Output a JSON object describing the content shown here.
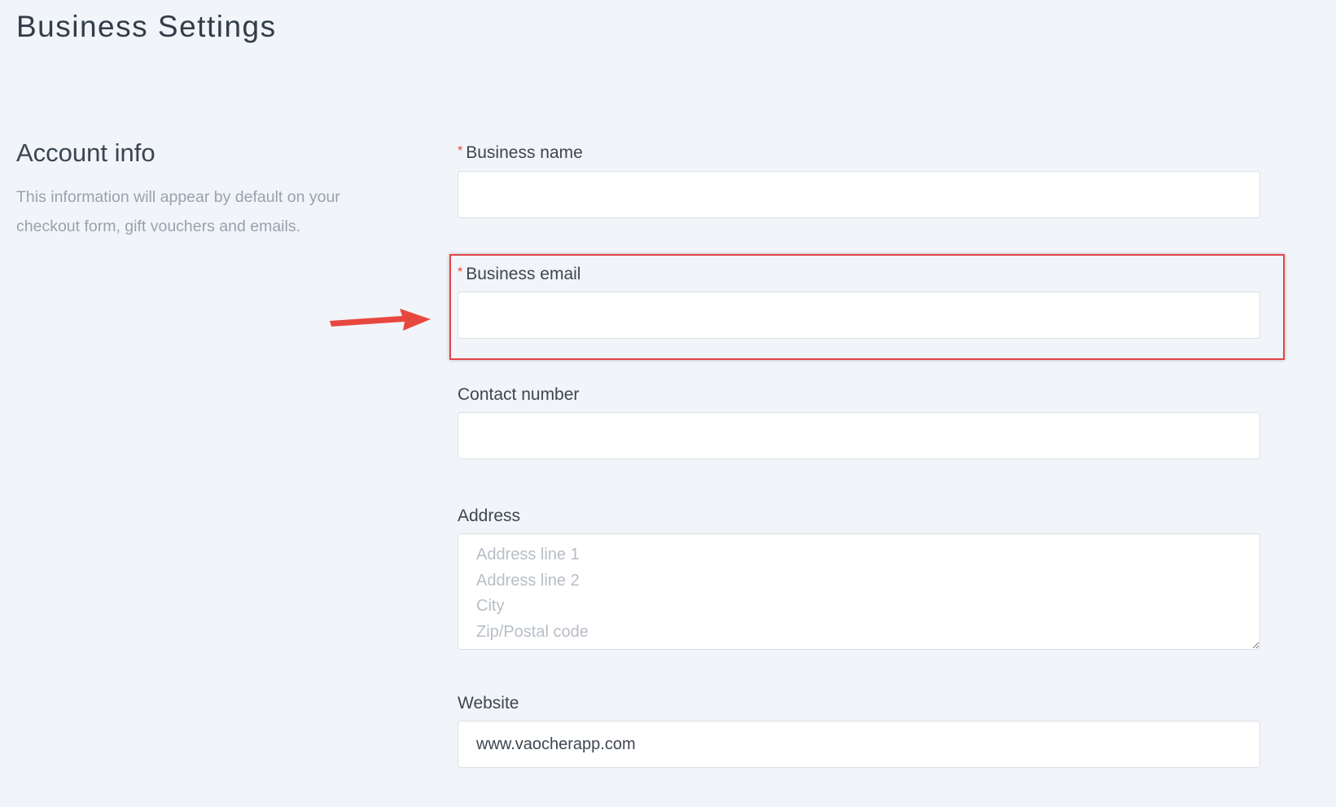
{
  "page": {
    "title": "Business Settings"
  },
  "section": {
    "title": "Account info",
    "description": "This information will appear by default on your checkout form, gift vouchers and emails."
  },
  "form": {
    "business_name": {
      "label": "Business name",
      "required_mark": "*",
      "value": ""
    },
    "business_email": {
      "label": "Business email",
      "required_mark": "*",
      "value": ""
    },
    "contact_number": {
      "label": "Contact number",
      "value": ""
    },
    "address": {
      "label": "Address",
      "placeholder": "Address line 1\nAddress line 2\nCity\nZip/Postal code",
      "value": ""
    },
    "website": {
      "label": "Website",
      "value": "www.vaocherapp.com"
    }
  },
  "annotation": {
    "highlight_color": "#e24549",
    "arrow_color": "#e8473f"
  }
}
